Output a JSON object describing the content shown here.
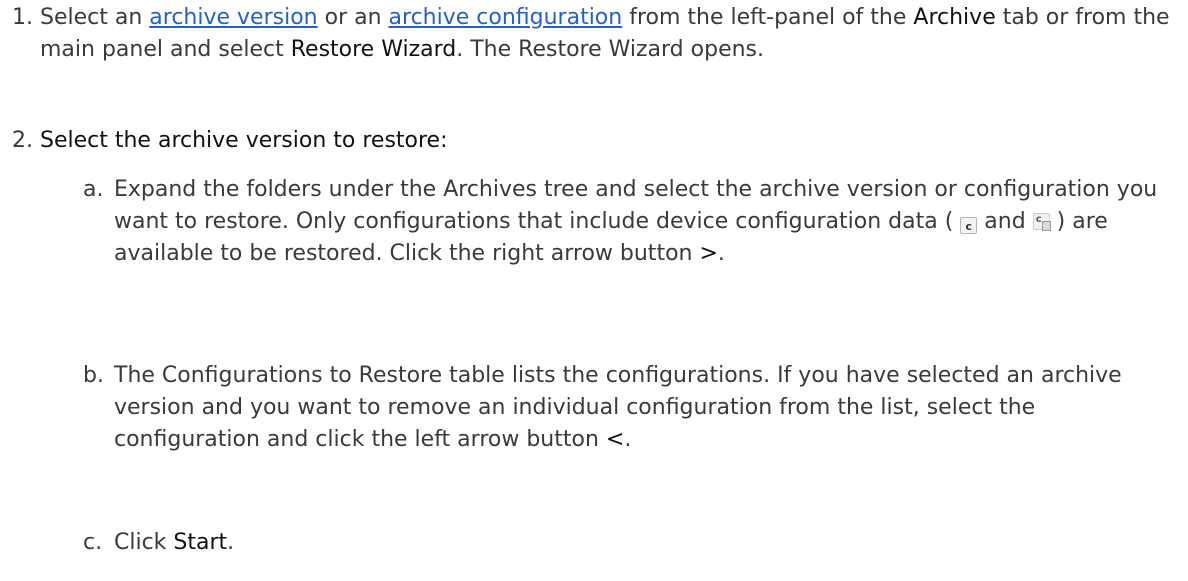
{
  "step1": {
    "num": "1.",
    "t1": "Select an ",
    "link1": "archive version",
    "t2": " or an ",
    "link2": "archive configuration",
    "t3": " from the left-panel of the ",
    "archive": "Archive",
    "t4": " tab or from the main panel and select ",
    "wizard": "Restore Wizard",
    "t5": ". The Restore Wizard opens."
  },
  "step2": {
    "num": "2.",
    "text": "Select the archive version to restore:"
  },
  "sub_a": {
    "num": "a.",
    "t1": "Expand the folders under the Archives tree and select the archive version or configuration you want to restore. Only configurations that include device configuration data ( ",
    "icon1_letter": "c",
    "t2": " and ",
    "icon2_letter": "c",
    "t3": " ) are available to be restored. Click the right arrow button ",
    "gt": ">",
    "t4": "."
  },
  "sub_b": {
    "num": "b.",
    "t1": "The Configurations to Restore table lists the configurations. If you have selected an archive version and you want to remove an individual configuration from the list, select the configuration and click the left arrow button ",
    "lt": "<",
    "t2": "."
  },
  "sub_c": {
    "num": "c.",
    "t1": "Click ",
    "start": "Start",
    "t2": "."
  },
  "icons": [
    "config-data-icon",
    "config-item-icon"
  ]
}
